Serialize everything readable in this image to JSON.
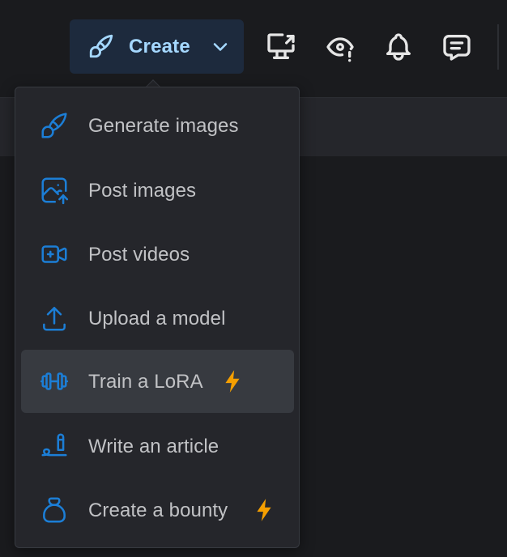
{
  "header": {
    "create_label": "Create",
    "icons": [
      "brush-icon",
      "chevron-down-icon",
      "cast-icon",
      "eye-alert-icon",
      "bell-icon",
      "message-icon"
    ]
  },
  "menu": {
    "items": [
      {
        "label": "Generate images",
        "icon": "brush-icon",
        "badge": ""
      },
      {
        "label": "Post images",
        "icon": "photo-upload-icon",
        "badge": ""
      },
      {
        "label": "Post videos",
        "icon": "video-plus-icon",
        "badge": ""
      },
      {
        "label": "Upload a model",
        "icon": "upload-icon",
        "badge": ""
      },
      {
        "label": "Train a LoRA",
        "icon": "barbell-icon",
        "badge": "bolt-icon"
      },
      {
        "label": "Write an article",
        "icon": "pencil-line-icon",
        "badge": ""
      },
      {
        "label": "Create a bounty",
        "icon": "moneybag-icon",
        "badge": "bolt-icon"
      }
    ]
  },
  "colors": {
    "accent": "#a5d8ff",
    "icon_blue": "#1c7ed6",
    "bolt": "#f59f00",
    "menu_bg": "#25262b",
    "page_bg": "#1a1b1e"
  }
}
